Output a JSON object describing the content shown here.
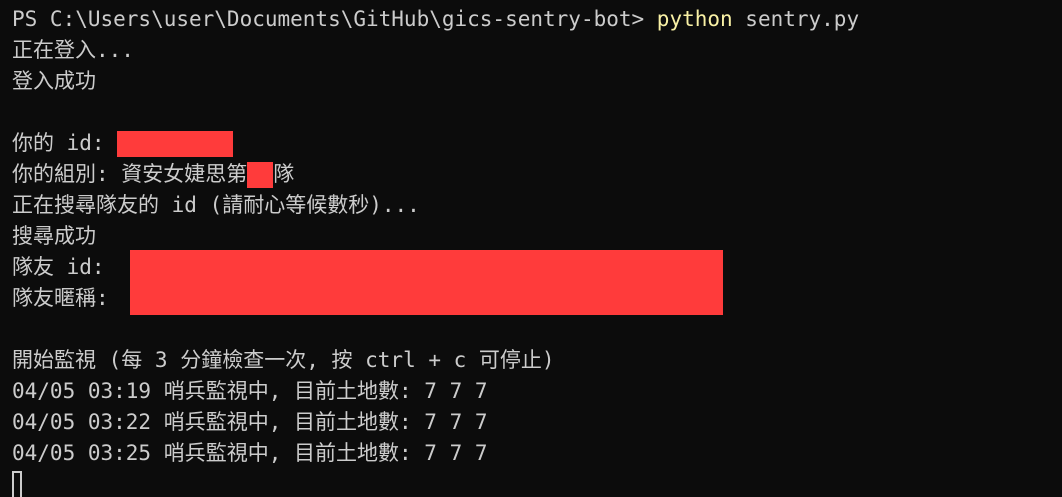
{
  "terminal": {
    "prompt": "PS C:\\Users\\user\\Documents\\GitHub\\gics-sentry-bot> ",
    "command": "python",
    "args": " sentry.py",
    "lines": {
      "logging_in": "正在登入...",
      "login_ok": "登入成功",
      "your_id": "你的 id: ",
      "your_group_prefix": "你的組別: 資安女婕思第",
      "your_group_suffix": "隊",
      "searching": "正在搜尋隊友的 id (請耐心等候數秒)...",
      "search_ok": "搜尋成功",
      "teammate_id": "隊友 id: ",
      "teammate_nick": "隊友暱稱:",
      "start_monitor": "開始監視 (每 3 分鐘檢查一次, 按 ctrl + c 可停止)",
      "log1": "04/05 03:19 哨兵監視中, 目前土地數: 7 7 7",
      "log2": "04/05 03:22 哨兵監視中, 目前土地數: 7 7 7",
      "log3": "04/05 03:25 哨兵監視中, 目前土地數: 7 7 7"
    }
  },
  "colors": {
    "background": "#0c0c0c",
    "text": "#cccccc",
    "command": "#f9f1a5",
    "redaction": "#ff3b3b"
  }
}
